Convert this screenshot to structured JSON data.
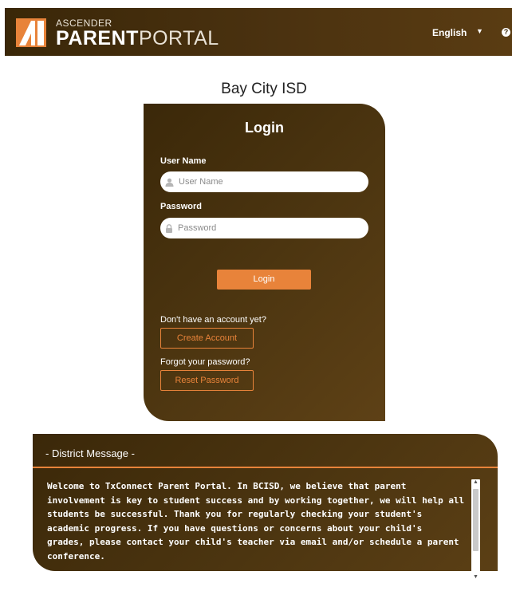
{
  "header": {
    "brand_small": "ASCENDER",
    "brand_main_bold": "PARENT",
    "brand_main_light": "PORTAL",
    "language": "English",
    "colors": {
      "bar": "#3a2708",
      "accent": "#e8833a",
      "logo_orange": "#e8833a"
    }
  },
  "district": {
    "name": "Bay City ISD"
  },
  "login": {
    "title": "Login",
    "username_label": "User Name",
    "username_placeholder": "User Name",
    "password_label": "Password",
    "password_placeholder": "Password",
    "login_button": "Login",
    "no_account_text": "Don't have an account yet?",
    "create_account_button": "Create Account",
    "forgot_text": "Forgot your password?",
    "reset_button": "Reset Password"
  },
  "message": {
    "title": "- District Message -",
    "lines": [
      "Welcome to TxConnect Parent Portal.  In BCISD, we believe that parent",
      "involvement is key to student success and by working together, we will help all",
      "students be successful.  Thank you for regularly checking your student's",
      "academic progress.  If you have questions or concerns about your child's",
      "grades, please contact your child's teacher via email and/or schedule a parent",
      "conference."
    ]
  }
}
